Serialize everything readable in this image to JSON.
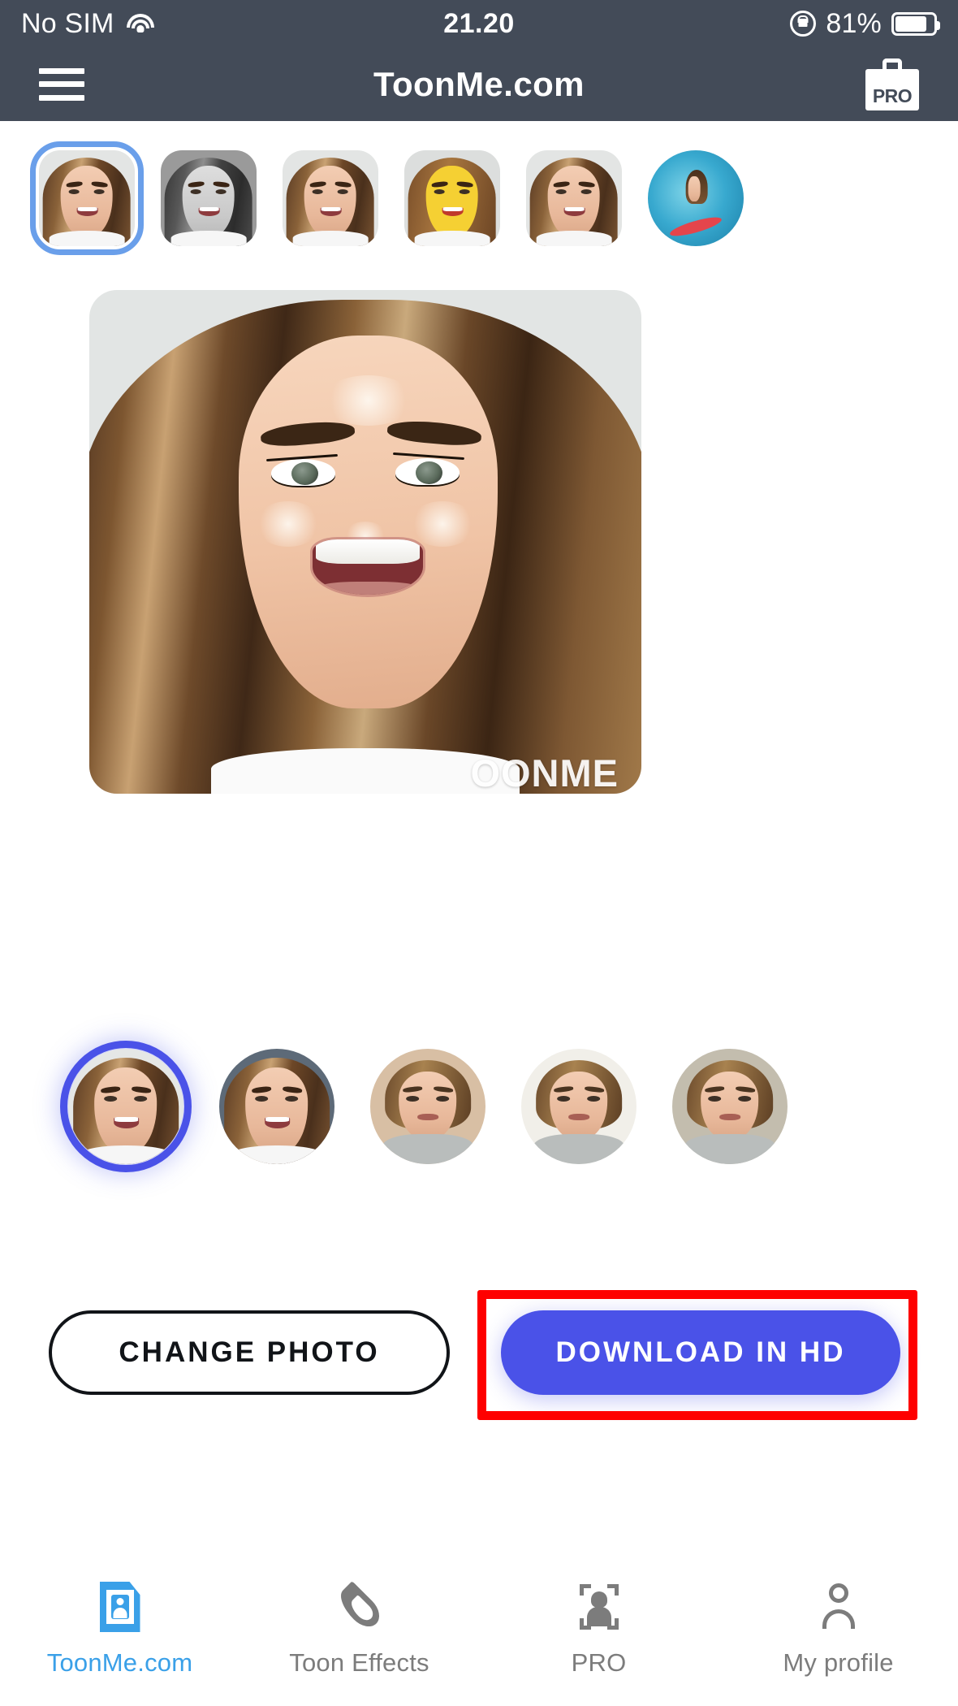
{
  "status_bar": {
    "carrier": "No SIM",
    "wifi_icon": "wifi-icon",
    "time": "21.20",
    "rotation_lock_icon": "rotation-lock-icon",
    "battery_percent": "81%",
    "battery_icon": "battery-icon",
    "background_color": "#434b58"
  },
  "header": {
    "menu_icon": "hamburger-menu-icon",
    "title": "ToonMe.com",
    "pro_badge_label": "PRO",
    "pro_icon": "shopping-bag-pro-icon",
    "background_color": "#434b58"
  },
  "style_strip": {
    "selected_index": 0,
    "selected_border_color": "#6a9fea",
    "items": [
      {
        "name": "style-realistic-portrait",
        "variant": "v-plain",
        "selected": true
      },
      {
        "name": "style-black-and-white",
        "variant": "v-bw",
        "selected": false
      },
      {
        "name": "style-soft-cartoon",
        "variant": "v-plain",
        "selected": false
      },
      {
        "name": "style-yellow-cartoon",
        "variant": "v-yellow",
        "selected": false
      },
      {
        "name": "style-light-sketch",
        "variant": "v-plain",
        "selected": false
      },
      {
        "name": "style-surf-scene",
        "variant": "v-surf",
        "selected": false
      }
    ]
  },
  "preview": {
    "name": "cartoon-portrait-preview",
    "watermark": "OONME",
    "background_color": "#e2e5e4"
  },
  "avatar_row": {
    "selected_index": 0,
    "selected_ring_color": "#4a52e8",
    "items": [
      {
        "name": "avatar-variant-1",
        "variant": "v-plain",
        "bg": "a-bgA",
        "selected": true
      },
      {
        "name": "avatar-variant-2",
        "variant": "v-plain",
        "bg": "a-bgB",
        "selected": false
      },
      {
        "name": "avatar-variant-3",
        "variant": "v-male",
        "bg": "a-bgC",
        "selected": false
      },
      {
        "name": "avatar-variant-4",
        "variant": "v-male",
        "bg": "a-bgD",
        "selected": false
      },
      {
        "name": "avatar-variant-5",
        "variant": "v-male",
        "bg": "a-bgE",
        "selected": false
      }
    ]
  },
  "actions": {
    "change_photo_label": "CHANGE PHOTO",
    "download_label": "DOWNLOAD IN HD",
    "download_color": "#4a52e8",
    "highlight_color": "#fe0000"
  },
  "bottom_nav": {
    "active_index": 0,
    "active_color": "#3aa0e8",
    "inactive_color": "#7c7c7c",
    "items": [
      {
        "label": "ToonMe.com",
        "icon": "toonme-photo-icon",
        "active": true
      },
      {
        "label": "Toon Effects",
        "icon": "flame-icon",
        "active": false
      },
      {
        "label": "PRO",
        "icon": "scan-portrait-icon",
        "active": false
      },
      {
        "label": "My profile",
        "icon": "person-icon",
        "active": false
      }
    ]
  }
}
